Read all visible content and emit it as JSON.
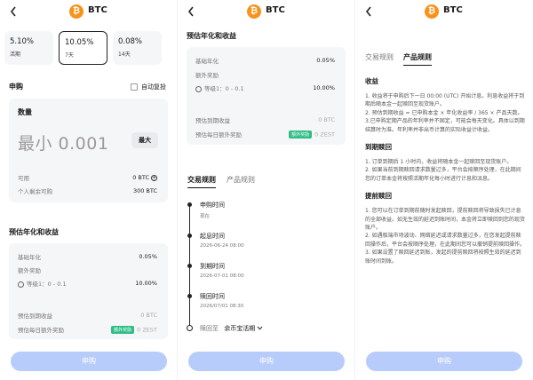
{
  "header": {
    "coin_symbol": "₿",
    "title": "BTC"
  },
  "tiles": [
    {
      "rate": "5.10%",
      "period": "活期"
    },
    {
      "rate": "10.05%",
      "period": "7天"
    },
    {
      "rate": "0.08%",
      "period": "14天"
    }
  ],
  "subscribe": {
    "title": "申购",
    "auto_renew_label": "自动复投",
    "amount_label": "数量",
    "amount_placeholder": "最小 0.001",
    "max_label": "最大",
    "available_label": "可用",
    "available_value": "0 BTC",
    "remaining_quota_label": "个人剩余可购",
    "remaining_quota_value": "300 BTC"
  },
  "estimate": {
    "title": "预估年化和收益",
    "base_label": "基础年化",
    "base_value": "0.05%",
    "bonus_label": "额外奖励",
    "tier_label": "等级1：",
    "tier_range": "0 - 0.1",
    "tier_value": "10.00%",
    "expected_label": "预估到期收益",
    "expected_value": "0 BTC",
    "daily_bonus_label": "预估每日额外奖励",
    "bonus_tag": "额外奖励",
    "daily_bonus_value": "0 ZEST"
  },
  "tabs": {
    "rules": "交易规则",
    "product_rules": "产品规则"
  },
  "timeline": [
    {
      "label": "申购时间",
      "value": "现在"
    },
    {
      "label": "起息时间",
      "value": "2026-06-24 08:00"
    },
    {
      "label": "到期时间",
      "value": "2026-07-01 08:00"
    },
    {
      "label": "赎回时间",
      "value": "2026/07/01 08:30"
    }
  ],
  "redeem_to": {
    "label": "赎回至",
    "target": "余币宝活期"
  },
  "apply_button": "申购",
  "product_rules": {
    "income_title": "收益",
    "income_items": [
      "1. 收益将于申购后下一日 00:00 (UTC) 开始计息。利息收益将于到期后随本金一起赎回至现货账户。",
      "2. 预估到期收益 = 已申购本金 × 年化收益率 / 365 × 产品天数。",
      "3.已申购定期产品的年利率并不固定，可能会每天变化。具体以到期结算时为准。年利率并非出币计算的实际收益计收益。"
    ],
    "maturity_title": "到期赎回",
    "maturity_items": [
      "1. 订单到期后 1 小时内，收益将随本金一起赎回至现货账户。",
      "2. 如果当前到期赎回请求数量过多，平台会按顺序处理，在此期间您的订单本金将按照活期年化每小时进行计息和派息。"
    ],
    "early_title": "提前赎回",
    "early_items": [
      "1. 您可以在订单到期前随时发起赎回，提前赎回将导致损失已计息的全部收益。如无生效的延迟到账时间，本金将立即赎回到您的现货账户。",
      "2. 如遇极端市场波动、网络延迟或请求数量过多，在您发起提前赎回操作后，平台会按顺序处理，在此期间您可以撤销提前赎回操作。",
      "3. 如果设置了赎回延迟到账，发起的提前赎回将按照生效的延迟到账时间到账。"
    ]
  }
}
